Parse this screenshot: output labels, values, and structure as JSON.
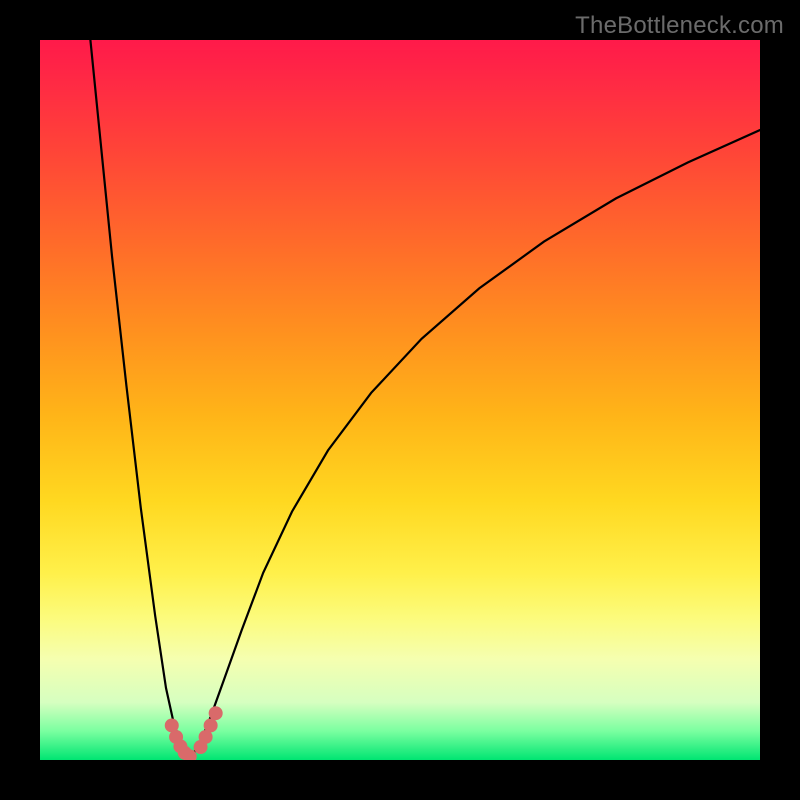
{
  "watermark": "TheBottleneck.com",
  "colors": {
    "background": "#000000",
    "curve": "#000000",
    "marker": "#d96a6a",
    "gradient_top": "#ff1a4a",
    "gradient_mid": "#ffd820",
    "gradient_bottom": "#00e572"
  },
  "chart_data": {
    "type": "line",
    "title": "",
    "xlabel": "",
    "ylabel": "",
    "xlim": [
      0,
      100
    ],
    "ylim": [
      0,
      100
    ],
    "series": [
      {
        "name": "bottleneck-curve-left",
        "x": [
          7,
          8.5,
          10,
          12,
          14,
          16,
          17.5,
          18.6,
          19.5,
          20.2,
          20.8
        ],
        "y": [
          100,
          85,
          70,
          52,
          35,
          20,
          10,
          5,
          2.5,
          1.0,
          0.3
        ]
      },
      {
        "name": "bottleneck-curve-right",
        "x": [
          20.8,
          21.5,
          22.5,
          23.7,
          25.5,
          28,
          31,
          35,
          40,
          46,
          53,
          61,
          70,
          80,
          90,
          100
        ],
        "y": [
          0.3,
          1.2,
          3.0,
          6,
          11,
          18,
          26,
          34.5,
          43,
          51,
          58.5,
          65.5,
          72,
          78,
          83,
          87.5
        ]
      }
    ],
    "markers": [
      {
        "x": 18.3,
        "y": 4.8
      },
      {
        "x": 18.9,
        "y": 3.2
      },
      {
        "x": 19.5,
        "y": 1.9
      },
      {
        "x": 20.1,
        "y": 1.0
      },
      {
        "x": 20.8,
        "y": 0.5
      },
      {
        "x": 22.3,
        "y": 1.8
      },
      {
        "x": 23.0,
        "y": 3.2
      },
      {
        "x": 23.7,
        "y": 4.8
      },
      {
        "x": 24.4,
        "y": 6.5
      }
    ],
    "grid": false,
    "legend": false
  }
}
